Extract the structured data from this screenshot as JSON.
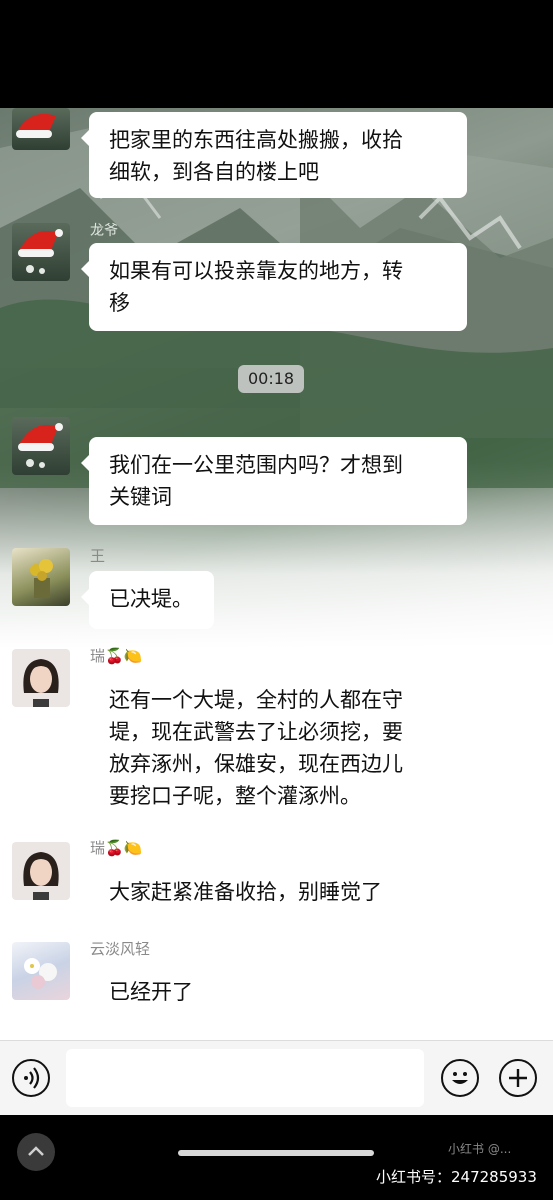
{
  "messages": [
    {
      "text": "把家里的东西往高处搬搬，收拾\n细软，到各自的楼上吧"
    },
    {
      "text": "如果有可以投亲靠友的地方，转\n移",
      "sender": "龙爷"
    },
    {
      "text": "我们在一公里范围内吗？才想到\n关键词"
    },
    {
      "text": "已决堤。",
      "sender": "王"
    },
    {
      "text": "还有一个大堤，全村的人都在守\n堤，现在武警去了让必须挖，要\n放弃涿州，保雄安，现在西边儿\n要挖口子呢，整个灌涿州。",
      "sender": "瑞🍒🍋"
    },
    {
      "text": "大家赶紧准备收拾，别睡觉了",
      "sender": "瑞🍒🍋"
    },
    {
      "text": "已经开了",
      "sender": "云淡风轻"
    }
  ],
  "voice_time": "00:18",
  "watermark": "小红书号：247285933",
  "watermark_logo": "小红书 @..."
}
